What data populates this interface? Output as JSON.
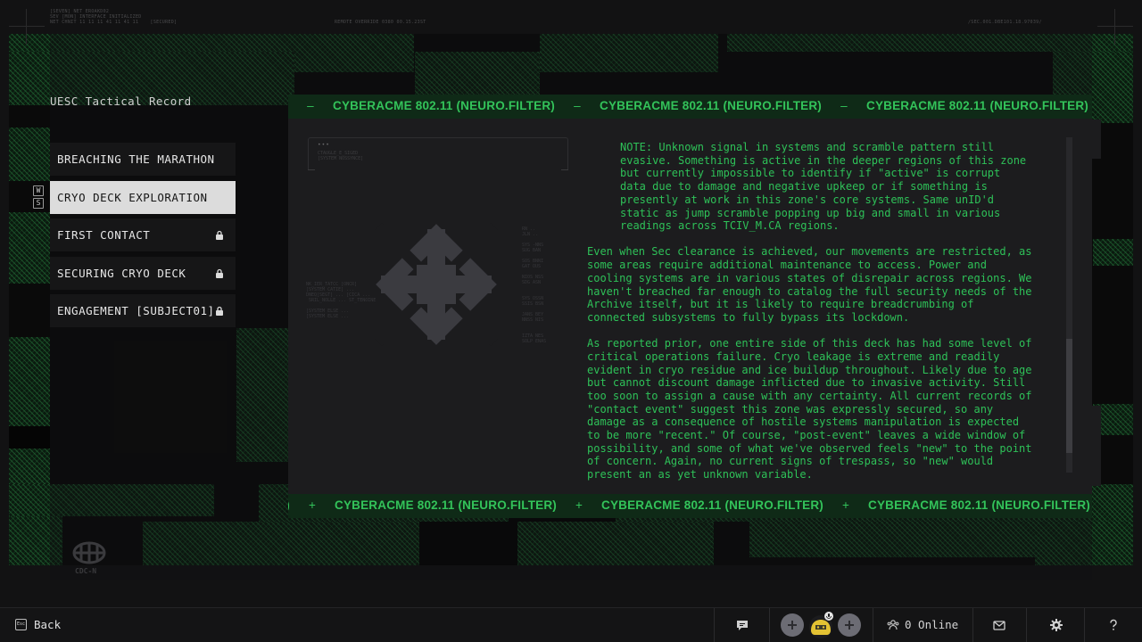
{
  "hud": {
    "top_left": "[SEVEN] NET EROAKD02\nSEV [MON] INTERFACE INITIALIZED\nNET CHNIT 11 11 11 41 11 41 11    [SECURED]",
    "top_center": "REMOTE OVERRIDE 0380 00.15.23ST",
    "top_right": "/SEC.001.DBE101.18.97039/"
  },
  "sidebar": {
    "title": "UESC Tactical Record",
    "hotkeys": [
      "W",
      "S"
    ],
    "items": [
      {
        "label": "BREACHING THE MARATHON",
        "locked": false,
        "active": false
      },
      {
        "label": "CRYO DECK EXPLORATION",
        "locked": false,
        "active": true
      },
      {
        "label": "FIRST CONTACT",
        "locked": true,
        "active": false
      },
      {
        "label": "SECURING CRYO DECK",
        "locked": true,
        "active": false
      },
      {
        "label": "ENGAGEMENT [SUBJECT01]",
        "locked": true,
        "active": false
      }
    ],
    "logo_text": "CDC-N"
  },
  "panel": {
    "ticker_text": "CYBERACME 802.11 (NEURO.FILTER)",
    "ticker_sep_top": "–",
    "ticker_sep_bottom": "+",
    "terminal": {
      "dots": "•••",
      "lines": "CTAUGLE_E_SIGED\n[SYSTEM NOSSYNCE]"
    },
    "faint_left": "NK_IER_TATCC [ONCR]\n[SYSTEM CATIE] ...\nDNEQ[SEGT] ... [CICA ...\n SRIL_NOLLE ... ST_TENOINE\n\n[SYSTEM ELSE ...\n[SYSTEM ELSE ...",
    "faint_right": "RN ..\nJLN ..\n\nSYS -NNS\nSUG BAN\n\nSOS BNNI\nGAT OUS\n\nNIOS NSS\nSDG ASN\n\n\nSYS OSSN\nSSIS BSN\n\nJANS BEY\nNNSS NIS\n\n\nIZTA NES\nSOLP ENAS",
    "paragraphs": [
      "NOTE: Unknown signal in systems and scramble pattern still\nevasive. Something is active in the deeper regions of this zone\nbut currently impossible to identify if \"active\" is corrupt\ndata due to damage and negative upkeep or if something is\npresently at work in this zone's core systems. Same unID'd\nstatic as jump scramble popping up big and small in various\nreadings across TCIV_M.CA regions.",
      "Even when Sec clearance is achieved, our movements are restricted, as\nsome areas require additional maintenance to access. Power and\ncooling systems are in various states of disrepair across regions. We\nhaven't breached far enough to catalog the full security needs of the\nArchive itself, but it is likely to require breadcrumbing of\nconnected subsystems to fully bypass its lockdown.",
      "As reported prior, one entire side of this deck has had some level of\ncritical operations failure. Cryo leakage is extreme and readily\nevident in cryo residue and ice buildup throughout. Likely due to age\nbut cannot discount damage inflicted due to invasive activity. Still\ntoo soon to assign a cause with any certainty. All current records of\n\"contact event\" suggest this zone was expressly secured, so any\ndamage as a consequence of hostile systems manipulation is expected\nto be more \"recent.\" Of course, \"post-event\" leaves a wide window of\npossibility, and some of what we've observed feels \"new\" to the point\nof concern. Again, no current signs of trespass, so \"new\" would\npresent an as yet unknown variable."
    ],
    "scroll_position": 0.6
  },
  "bottombar": {
    "back_key": "Esc",
    "back_label": "Back",
    "online_label": "0 Online",
    "icons": [
      "chat-icon",
      "party-slot-icon",
      "avatar-icon",
      "party-slot-icon",
      "users-icon",
      "mail-icon",
      "gear-icon",
      "help-icon"
    ]
  },
  "colors": {
    "accent_green": "#2ec158",
    "ticker_bg": "#0f2a17",
    "active_item_bg": "#dcdcdc"
  }
}
